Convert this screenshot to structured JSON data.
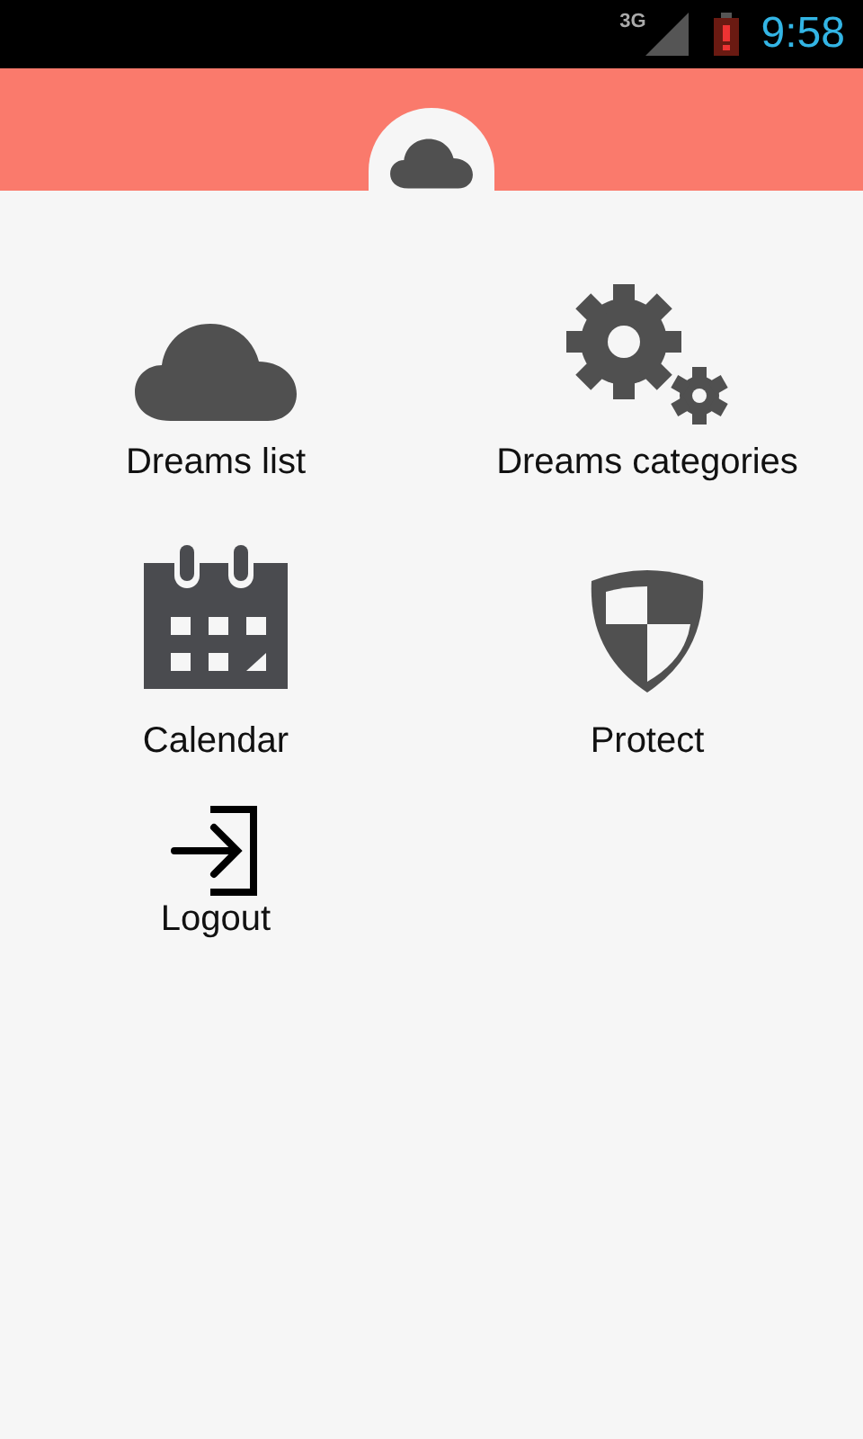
{
  "status_bar": {
    "network": "3G",
    "battery_low": true,
    "time": "9:58"
  },
  "header": {
    "kind": "cloud"
  },
  "menu": [
    {
      "kind": "cloud",
      "label": "Dreams list"
    },
    {
      "kind": "gears",
      "label": "Dreams categories"
    },
    {
      "kind": "calendar",
      "label": "Calendar"
    },
    {
      "kind": "shield",
      "label": "Protect"
    },
    {
      "kind": "logout",
      "label": "Logout"
    }
  ]
}
